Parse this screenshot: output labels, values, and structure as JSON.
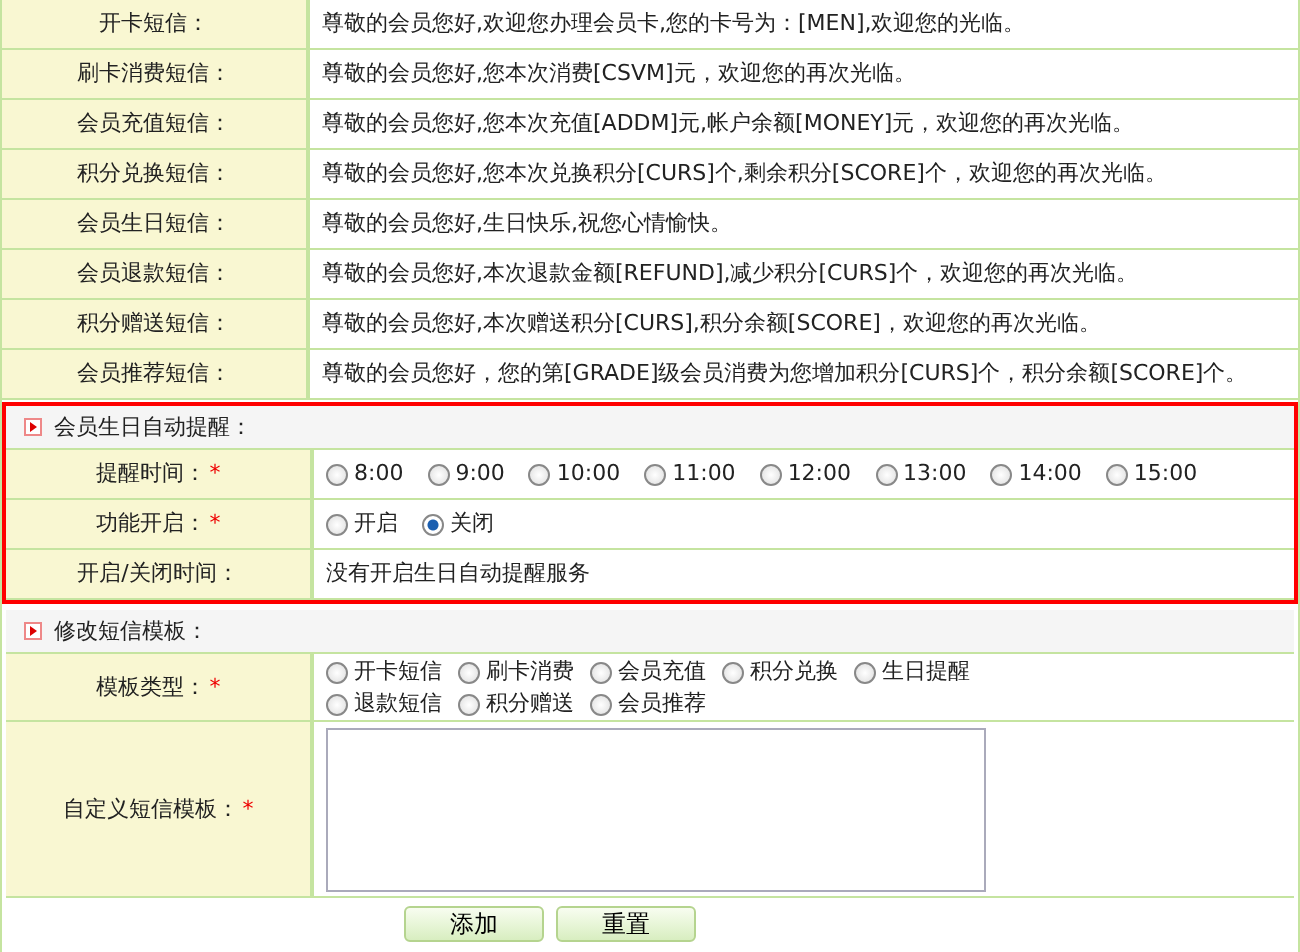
{
  "message_templates": [
    {
      "label": "开卡短信：",
      "text": "尊敬的会员您好,欢迎您办理会员卡,您的卡号为：[MEN],欢迎您的光临。"
    },
    {
      "label": "刷卡消费短信：",
      "text": "尊敬的会员您好,您本次消费[CSVM]元，欢迎您的再次光临。"
    },
    {
      "label": "会员充值短信：",
      "text": "尊敬的会员您好,您本次充值[ADDM]元,帐户余额[MONEY]元，欢迎您的再次光临。"
    },
    {
      "label": "积分兑换短信：",
      "text": "尊敬的会员您好,您本次兑换积分[CURS]个,剩余积分[SCORE]个，欢迎您的再次光临。"
    },
    {
      "label": "会员生日短信：",
      "text": "尊敬的会员您好,生日快乐,祝您心情愉快。"
    },
    {
      "label": "会员退款短信：",
      "text": "尊敬的会员您好,本次退款金额[REFUND],减少积分[CURS]个，欢迎您的再次光临。"
    },
    {
      "label": "积分赠送短信：",
      "text": "尊敬的会员您好,本次赠送积分[CURS],积分余额[SCORE]，欢迎您的再次光临。"
    },
    {
      "label": "会员推荐短信：",
      "text": "尊敬的会员您好，您的第[GRADE]级会员消费为您增加积分[CURS]个，积分余额[SCORE]个。"
    }
  ],
  "birthday_reminder": {
    "title": "会员生日自动提醒：",
    "highlighted": true,
    "rows": [
      {
        "kind": "radios",
        "label": "提醒时间：",
        "required_mark": "*",
        "options": [
          {
            "label": "8:00",
            "selected": false
          },
          {
            "label": "9:00",
            "selected": false
          },
          {
            "label": "10:00",
            "selected": false
          },
          {
            "label": "11:00",
            "selected": false
          },
          {
            "label": "12:00",
            "selected": false
          },
          {
            "label": "13:00",
            "selected": false
          },
          {
            "label": "14:00",
            "selected": false
          },
          {
            "label": "15:00",
            "selected": false
          }
        ]
      },
      {
        "kind": "radios",
        "label": "功能开启：",
        "required_mark": "*",
        "options": [
          {
            "label": "开启",
            "selected": false
          },
          {
            "label": "关闭",
            "selected": true
          }
        ]
      },
      {
        "kind": "text",
        "label": "开启/关闭时间：",
        "text": "没有开启生日自动提醒服务"
      }
    ]
  },
  "edit_template": {
    "title": "修改短信模板：",
    "highlighted": false,
    "rows": [
      {
        "kind": "radios",
        "label": "模板类型：",
        "required_mark": "*",
        "options": [
          {
            "label": "开卡短信",
            "selected": false
          },
          {
            "label": "刷卡消费",
            "selected": false
          },
          {
            "label": "会员充值",
            "selected": false
          },
          {
            "label": "积分兑换",
            "selected": false
          },
          {
            "label": "生日提醒",
            "selected": false
          },
          {
            "label": "退款短信",
            "selected": false
          },
          {
            "label": "积分赠送",
            "selected": false
          },
          {
            "label": "会员推荐",
            "selected": false
          }
        ]
      },
      {
        "kind": "textarea",
        "label": "自定义短信模板：",
        "required_mark": "*"
      }
    ]
  },
  "buttons": [
    "添加",
    "重置"
  ]
}
